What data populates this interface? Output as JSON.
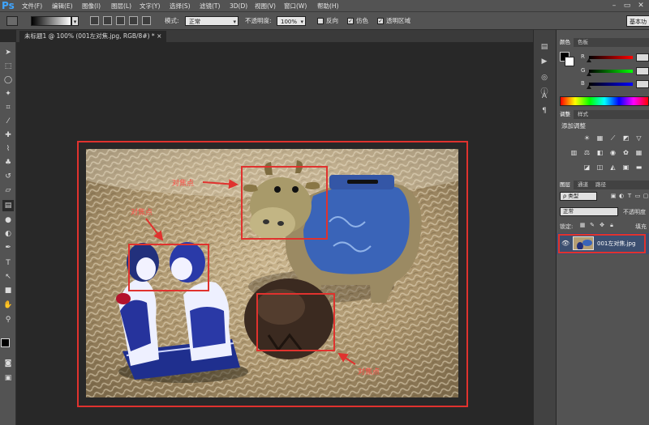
{
  "app": {
    "logo": "Ps"
  },
  "menu": [
    "文件(F)",
    "编辑(E)",
    "图像(I)",
    "图层(L)",
    "文字(Y)",
    "选择(S)",
    "滤镜(T)",
    "3D(D)",
    "视图(V)",
    "窗口(W)",
    "帮助(H)"
  ],
  "options": {
    "mode_label": "模式:",
    "mode_value": "正常",
    "opacity_label": "不透明度:",
    "opacity_value": "100%",
    "reverse_label": "反向",
    "dither_label": "仿色",
    "transparency_label": "透明区域",
    "workspace": "基本功"
  },
  "document": {
    "tab_title": "未标题1 @ 100% (001左对焦.jpg, RGB/8#) *",
    "annotations": [
      "对焦点",
      "对焦点",
      "对焦点"
    ]
  },
  "panels": {
    "color": {
      "tabs": [
        "颜色",
        "色板"
      ],
      "channels": [
        "R",
        "G",
        "B"
      ]
    },
    "adjustments": {
      "tabs": [
        "调整",
        "样式"
      ],
      "title": "添加调整"
    },
    "layers": {
      "tabs": [
        "图层",
        "通道",
        "路径"
      ],
      "filter_label": "ρ 类型",
      "blend_mode": "正常",
      "opacity_label": "不透明度",
      "lock_label": "锁定:",
      "fill_label": "填充",
      "items": [
        {
          "name": "001左对焦.jpg",
          "visible": true
        }
      ]
    }
  },
  "colors": {
    "accent_red": "#e0322e",
    "ps_blue": "#3fa5ff",
    "layer_selected": "#3c4f70"
  }
}
